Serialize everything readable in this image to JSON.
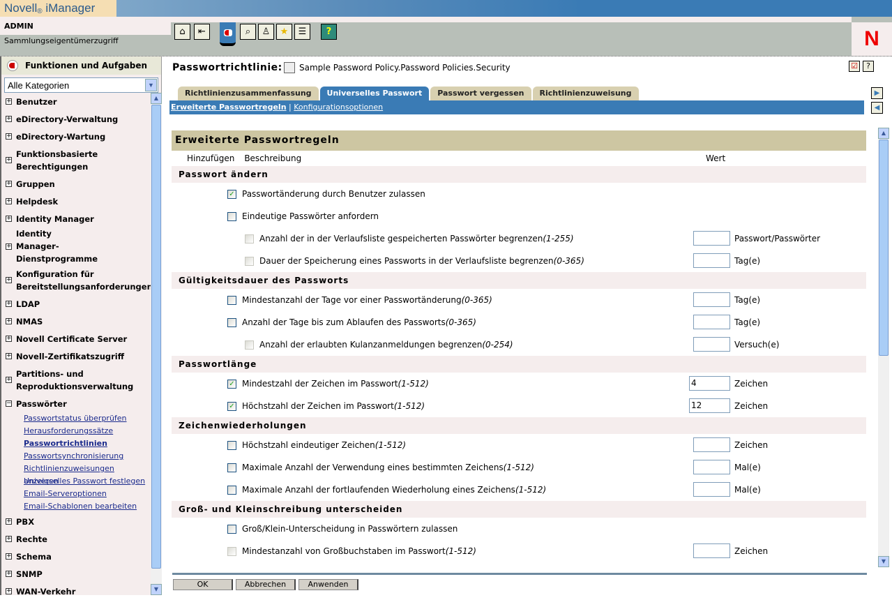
{
  "app": {
    "brand": "Novell",
    "brand_mark": "®",
    "product": "iManager",
    "user": "ADMIN",
    "role": "Sammlungseigentümerzugriff",
    "logo": "N"
  },
  "toolbar": [
    {
      "icon": "home-icon",
      "glyph": "⌂"
    },
    {
      "icon": "exit-icon",
      "glyph": "⇤"
    },
    {
      "icon": "roles-tasks-icon",
      "glyph": "◐",
      "active": true
    },
    {
      "icon": "view-objects-icon",
      "glyph": "🔍"
    },
    {
      "icon": "configure-icon",
      "glyph": "♙"
    },
    {
      "icon": "favorites-icon",
      "glyph": "★"
    },
    {
      "icon": "task-list-icon",
      "glyph": "☰"
    },
    {
      "icon": "help-book-icon",
      "glyph": "?"
    }
  ],
  "sidebar": {
    "title": "Funktionen und Aufgaben",
    "category": "Alle Kategorien",
    "items": [
      {
        "label": "Benutzer"
      },
      {
        "label": "eDirectory-Verwaltung"
      },
      {
        "label": "eDirectory-Wartung"
      },
      {
        "label": "Funktionsbasierte Berechtigungen"
      },
      {
        "label": "Gruppen"
      },
      {
        "label": "Helpdesk"
      },
      {
        "label": "Identity Manager"
      },
      {
        "label": "Identity Manager-Dienstprogramme"
      },
      {
        "label": "Konfiguration für Bereitstellungsanforderungen"
      },
      {
        "label": "LDAP"
      },
      {
        "label": "NMAS"
      },
      {
        "label": "Novell Certificate Server"
      },
      {
        "label": "Novell-Zertifikatszugriff"
      },
      {
        "label": "Partitions- und Reproduktionsverwaltung"
      },
      {
        "label": "Passwörter",
        "expanded": true,
        "children": [
          "Passwortstatus überprüfen",
          "Herausforderungssätze",
          "Passwortrichtlinien",
          "Passwortsynchronisierung",
          "Richtlinienzuweisungen anzeigen",
          "Universelles Passwort festlegen",
          "Email-Serveroptionen",
          "Email-Schablonen bearbeiten"
        ],
        "current": "Passwortrichtlinien"
      },
      {
        "label": "PBX"
      },
      {
        "label": "Rechte"
      },
      {
        "label": "Schema"
      },
      {
        "label": "SNMP"
      },
      {
        "label": "WAN-Verkehr"
      }
    ]
  },
  "page": {
    "title": "Passwortrichtlinie:",
    "object": "Sample Password Policy.Password Policies.Security",
    "tabs": [
      "Richtlinienzusammenfassung",
      "Universelles Passwort",
      "Passwort vergessen",
      "Richtlinienzuweisung"
    ],
    "active_tab": "Universelles Passwort",
    "subnav": [
      "Erweiterte Passwortregeln",
      "Konfigurationsoptionen"
    ],
    "subnav_sep": "|",
    "section": "Erweiterte Passwortregeln",
    "col_add": "Hinzufügen",
    "col_desc": "Beschreibung",
    "col_value": "Wert",
    "groups": [
      {
        "title": "Passwort ändern",
        "rows": [
          {
            "label": "Passwortänderung durch Benutzer zulassen",
            "checked": true
          },
          {
            "label": "Eindeutige Passwörter anfordern",
            "checked": false
          },
          {
            "label": "Anzahl der in der Verlaufsliste gespeicherten Passwörter begrenzen",
            "range": "(1-255)",
            "checked": false,
            "indent": true,
            "disabled": true,
            "value": "",
            "unit": "Passwort/Passwörter"
          },
          {
            "label": "Dauer der Speicherung eines Passworts in der Verlaufsliste begrenzen",
            "range": "(0-365)",
            "checked": false,
            "indent": true,
            "disabled": true,
            "value": "",
            "unit": "Tag(e)"
          }
        ]
      },
      {
        "title": "Gültigkeitsdauer des Passworts",
        "rows": [
          {
            "label": "Mindestanzahl der Tage vor einer Passwortänderung",
            "range": "(0-365)",
            "checked": false,
            "value": "",
            "unit": "Tag(e)"
          },
          {
            "label": "Anzahl der Tage bis zum Ablaufen des Passworts",
            "range": "(0-365)",
            "checked": false,
            "value": "",
            "unit": "Tag(e)"
          },
          {
            "label": "Anzahl der erlaubten Kulanzanmeldungen begrenzen",
            "range": "(0-254)",
            "checked": false,
            "indent": true,
            "disabled": true,
            "value": "",
            "unit": "Versuch(e)"
          }
        ]
      },
      {
        "title": "Passwortlänge",
        "rows": [
          {
            "label": "Mindestzahl der Zeichen im Passwort",
            "range": "(1-512)",
            "checked": true,
            "value": "4",
            "unit": "Zeichen"
          },
          {
            "label": "Höchstzahl der Zeichen im Passwort",
            "range": "(1-512)",
            "checked": true,
            "value": "12",
            "unit": "Zeichen"
          }
        ]
      },
      {
        "title": "Zeichenwiederholungen",
        "rows": [
          {
            "label": "Höchstzahl eindeutiger Zeichen",
            "range": "(1-512)",
            "checked": false,
            "value": "",
            "unit": "Zeichen"
          },
          {
            "label": "Maximale Anzahl der Verwendung eines bestimmten Zeichens",
            "range": "(1-512)",
            "checked": false,
            "value": "",
            "unit": "Mal(e)"
          },
          {
            "label": "Maximale Anzahl der fortlaufenden Wiederholung eines Zeichens",
            "range": "(1-512)",
            "checked": false,
            "value": "",
            "unit": "Mal(e)"
          }
        ]
      },
      {
        "title": "Groß- und Kleinschreibung unterscheiden",
        "rows": [
          {
            "label": "Groß/Klein-Unterscheidung in Passwörtern zulassen",
            "checked": false
          },
          {
            "label": "Mindestanzahl von Großbuchstaben im Passwort",
            "range": "(1-512)",
            "checked": false,
            "disabled": true,
            "value": "",
            "unit": "Zeichen"
          }
        ]
      }
    ],
    "buttons": {
      "ok": "OK",
      "cancel": "Abbrechen",
      "apply": "Anwenden"
    }
  }
}
